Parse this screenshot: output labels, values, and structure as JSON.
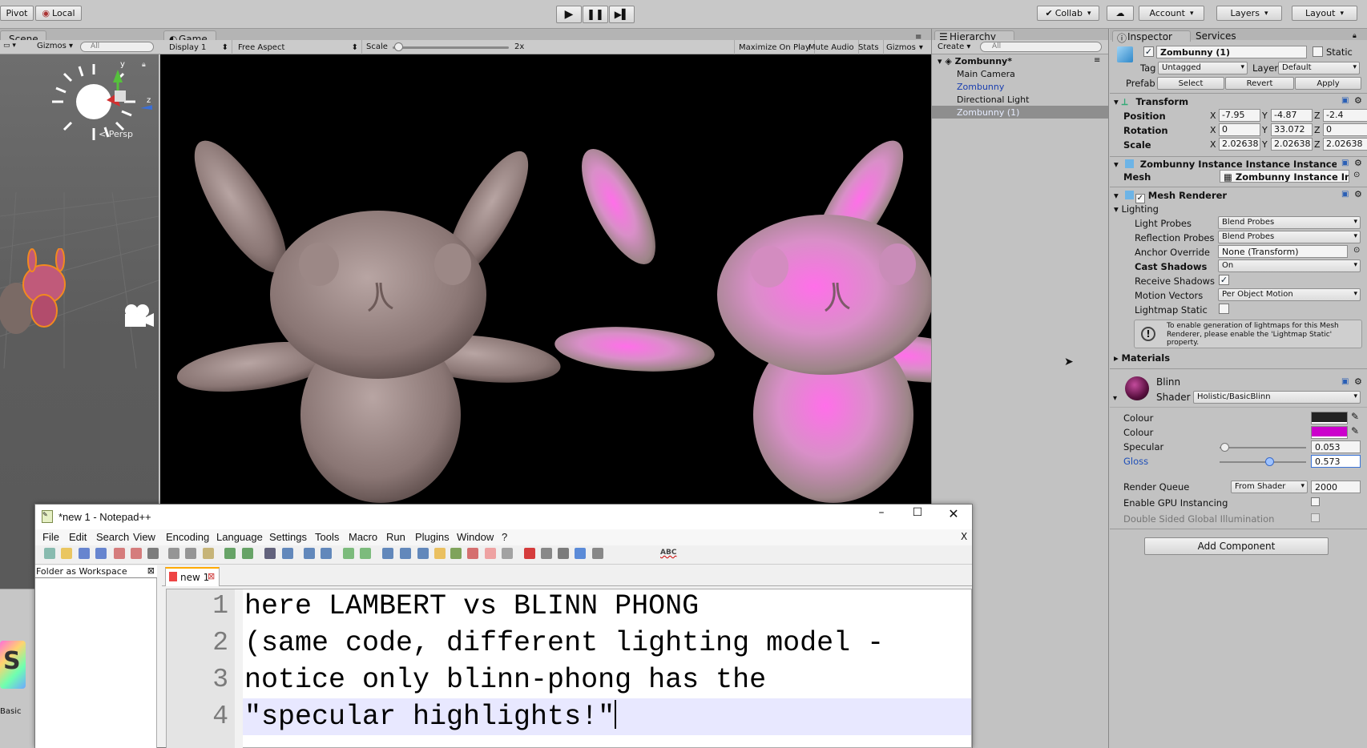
{
  "toolbar": {
    "pivot": "Pivot",
    "local": "Local",
    "collab": "Collab",
    "account": "Account",
    "layers": "Layers",
    "layout": "Layout"
  },
  "scene": {
    "tab": "Scene",
    "gizmos": "Gizmos",
    "search_placeholder": "All",
    "persp": "< Persp",
    "axis_y": "y",
    "axis_z": "z",
    "project_label": "Basic"
  },
  "game": {
    "tab": "Game",
    "display": "Display 1",
    "aspect": "Free Aspect",
    "scale_label": "Scale",
    "scale_value": "2x",
    "scale_fraction": 0.05,
    "maximize": "Maximize On Play",
    "mute": "Mute Audio",
    "stats": "Stats",
    "gizmos": "Gizmos"
  },
  "hierarchy": {
    "tab": "Hierarchy",
    "create": "Create",
    "search_placeholder": "All",
    "scene": "Zombunny*",
    "items": [
      "Main Camera",
      "Zombunny",
      "Directional Light",
      "Zombunny (1)"
    ]
  },
  "inspector": {
    "tab": "Inspector",
    "services_tab": "Services",
    "object_name": "Zombunny (1)",
    "static": "Static",
    "tag_label": "Tag",
    "tag": "Untagged",
    "layer_label": "Layer",
    "layer": "Default",
    "prefab_label": "Prefab",
    "select": "Select",
    "revert": "Revert",
    "apply": "Apply",
    "transform": {
      "title": "Transform",
      "position_label": "Position",
      "rotation_label": "Rotation",
      "scale_label": "Scale",
      "x": "X",
      "y": "Y",
      "z": "Z",
      "position": [
        "-7.95",
        "-4.87",
        "-2.4"
      ],
      "rotation": [
        "0",
        "33.072",
        "0"
      ],
      "scale": [
        "2.02638",
        "2.02638",
        "2.02638"
      ]
    },
    "mesh_filter": {
      "title": "Zombunny Instance Instance Instance",
      "mesh_label": "Mesh",
      "mesh": "Zombunny Instance Instance"
    },
    "mesh_renderer": {
      "title": "Mesh Renderer",
      "lighting": "Lighting",
      "light_probes_label": "Light Probes",
      "light_probes": "Blend Probes",
      "reflection_probes_label": "Reflection Probes",
      "reflection_probes": "Blend Probes",
      "anchor_override_label": "Anchor Override",
      "anchor_override": "None (Transform)",
      "cast_shadows_label": "Cast Shadows",
      "cast_shadows": "On",
      "receive_shadows_label": "Receive Shadows",
      "motion_vectors_label": "Motion Vectors",
      "motion_vectors": "Per Object Motion",
      "lightmap_static_label": "Lightmap Static",
      "info": "To enable generation of lightmaps for this Mesh Renderer, please enable the 'Lightmap Static' property.",
      "materials": "Materials"
    },
    "material": {
      "name": "Blinn",
      "shader_label": "Shader",
      "shader": "Holistic/BasicBlinn",
      "colour1_label": "Colour",
      "colour1": "#222222",
      "colour2_label": "Colour",
      "colour2": "#cc00cc",
      "specular_label": "Specular",
      "specular": "0.053",
      "gloss_label": "Gloss",
      "gloss": "0.573",
      "render_queue_label": "Render Queue",
      "render_queue_mode": "From Shader",
      "render_queue": "2000",
      "gpu_instancing_label": "Enable GPU Instancing",
      "double_sided_label": "Double Sided Global Illumination"
    },
    "add_component": "Add Component"
  },
  "notepad": {
    "title": "*new 1 - Notepad++",
    "menu": [
      "File",
      "Edit",
      "Search",
      "View",
      "Encoding",
      "Language",
      "Settings",
      "Tools",
      "Macro",
      "Run",
      "Plugins",
      "Window",
      "?"
    ],
    "close_x": "X",
    "workspace": "Folder as Workspace",
    "tab": "new 1",
    "line_numbers": [
      "1",
      "2",
      "3",
      "4"
    ],
    "lines": [
      "here LAMBERT vs BLINN PHONG",
      "(same code, different lighting model -",
      "notice only blinn-phong has the",
      "\"specular highlights!\""
    ],
    "abc": "ABC"
  }
}
